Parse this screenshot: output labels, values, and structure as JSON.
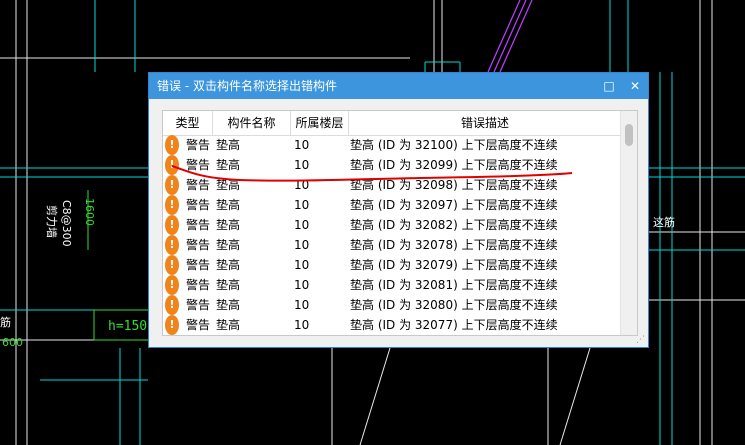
{
  "cad": {
    "left_label_1": "剪力墙",
    "left_label_2": "C8@300",
    "left_label_3": "1600",
    "height_box": "h=150",
    "left_600": "600",
    "left_partial": "筋",
    "right_label": "这筋"
  },
  "dialog": {
    "title": "错误 - 双击构件名称选择出错构件",
    "restore_glyph": "□",
    "close_glyph": "✕",
    "columns": {
      "type": "类型",
      "name": "构件名称",
      "floor": "所属楼层",
      "desc": "错误描述"
    },
    "rows": [
      {
        "type": "警告",
        "name": "垫高",
        "floor": "10",
        "desc": "垫高 (ID 为 32100) 上下层高度不连续"
      },
      {
        "type": "警告",
        "name": "垫高",
        "floor": "10",
        "desc": "垫高 (ID 为 32099) 上下层高度不连续"
      },
      {
        "type": "警告",
        "name": "垫高",
        "floor": "10",
        "desc": "垫高 (ID 为 32098) 上下层高度不连续"
      },
      {
        "type": "警告",
        "name": "垫高",
        "floor": "10",
        "desc": "垫高 (ID 为 32097) 上下层高度不连续"
      },
      {
        "type": "警告",
        "name": "垫高",
        "floor": "10",
        "desc": "垫高 (ID 为 32082) 上下层高度不连续"
      },
      {
        "type": "警告",
        "name": "垫高",
        "floor": "10",
        "desc": "垫高 (ID 为 32078) 上下层高度不连续"
      },
      {
        "type": "警告",
        "name": "垫高",
        "floor": "10",
        "desc": "垫高 (ID 为 32079) 上下层高度不连续"
      },
      {
        "type": "警告",
        "name": "垫高",
        "floor": "10",
        "desc": "垫高 (ID 为 32081) 上下层高度不连续"
      },
      {
        "type": "警告",
        "name": "垫高",
        "floor": "10",
        "desc": "垫高 (ID 为 32080) 上下层高度不连续"
      },
      {
        "type": "警告",
        "name": "垫高",
        "floor": "10",
        "desc": "垫高 (ID 为 32077) 上下层高度不连续"
      }
    ],
    "warn_icon": "warning-icon",
    "warn_color": "#f0841a"
  },
  "colors": {
    "cad_background": "#000000",
    "cad_cyan": "#00e0e0",
    "cad_white": "#ffffff",
    "cad_green": "#33dd33",
    "cad_magenta": "#c040ff",
    "titlebar": "#3c95dd",
    "annotation_red": "#e00000"
  }
}
